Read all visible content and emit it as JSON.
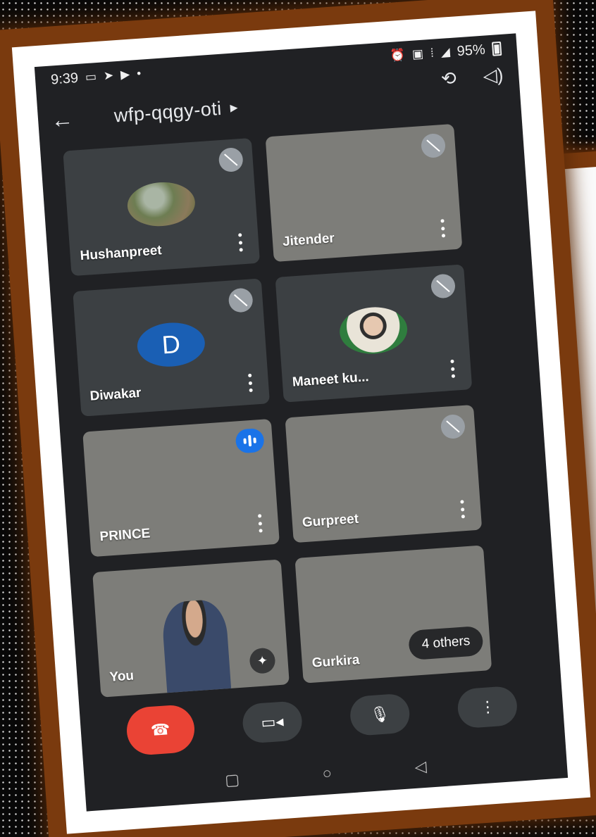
{
  "status_bar": {
    "time": "9:39",
    "battery": "95%",
    "icons": [
      "cast-icon",
      "telegram-icon",
      "youtube-icon",
      "dot-icon",
      "alarm-icon",
      "volte-icon",
      "vibrate-icon",
      "data-signal-icon",
      "signal-icon",
      "battery-icon"
    ]
  },
  "toolbar": {
    "meeting_code": "wfp-qqgy-oti",
    "back_icon": "back-arrow-icon",
    "switch_camera_icon": "switch-camera-icon",
    "audio_output_icon": "speaker-icon"
  },
  "participants": [
    {
      "name": "Hushanpreet",
      "muted": true
    },
    {
      "name": "Jitender",
      "muted": true
    },
    {
      "name": "Diwakar",
      "muted": true,
      "avatar_letter": "D"
    },
    {
      "name": "Maneet ku...",
      "muted": true
    },
    {
      "name": "PRINCE",
      "speaking": true
    },
    {
      "name": "Gurpreet",
      "muted": true
    },
    {
      "name": "You"
    },
    {
      "name": "Gurkira",
      "others_label": "4 others"
    }
  ],
  "controls": {
    "end_call": "end-call-icon",
    "camera": "camera-icon",
    "mic": "mic-icon",
    "more": "more-options-icon"
  },
  "colors": {
    "background": "#202124",
    "tile": "#3c4043",
    "end_call": "#ea4335",
    "speaking": "#1a73e8",
    "avatar_d": "#1a5fb4",
    "frame": "#7a3a0e"
  }
}
